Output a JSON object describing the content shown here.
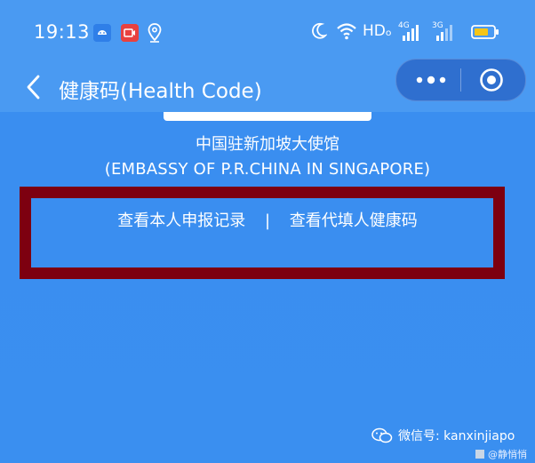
{
  "status_bar": {
    "time": "19:13",
    "hd_label": "HDₒ",
    "net_4g": "4G",
    "net_3g": "3G"
  },
  "nav": {
    "title": "健康码(Health Code)"
  },
  "org": {
    "name_cn": "中国驻新加坡大使馆",
    "name_en": "(EMBASSY OF P.R.CHINA IN SINGAPORE)"
  },
  "links": {
    "own_record": "查看本人申报记录",
    "separator": "|",
    "proxy_code": "查看代填人健康码"
  },
  "watermark": {
    "wechat": "微信号: kanxinjiapo",
    "author": "@静悄悄"
  },
  "colors": {
    "background": "#3b8ff0",
    "highlight_box": "#7d0010"
  }
}
